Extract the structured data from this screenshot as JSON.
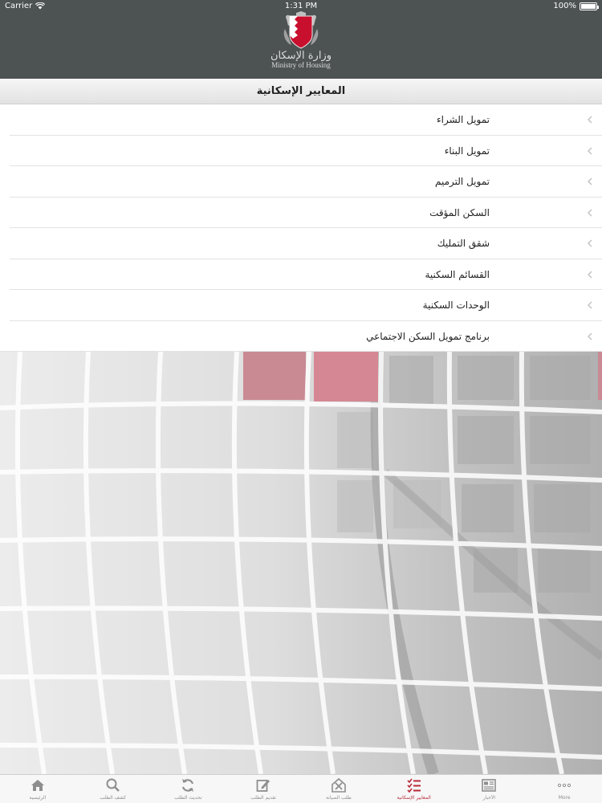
{
  "status_bar": {
    "carrier": "Carrier",
    "time": "1:31 PM",
    "battery": "100%"
  },
  "header": {
    "logo_arabic": "وزارة الإسكان",
    "logo_english": "Ministry of Housing"
  },
  "page_title": "المعايير الإسكانية",
  "items": [
    {
      "label": "تمويل الشراء"
    },
    {
      "label": "تمويل البناء"
    },
    {
      "label": "تمويل الترميم"
    },
    {
      "label": "السكن المؤقت"
    },
    {
      "label": "شقق التمليك"
    },
    {
      "label": "القسائم السكنية"
    },
    {
      "label": "الوحدات السكنية"
    },
    {
      "label": "برنامج تمويل السكن الاجتماعي"
    }
  ],
  "tabs": [
    {
      "label": "الرئيسية",
      "icon": "home-icon"
    },
    {
      "label": "كشف الطلب",
      "icon": "search-icon"
    },
    {
      "label": "تحديث الطلب",
      "icon": "refresh-icon"
    },
    {
      "label": "تقديم الطلب",
      "icon": "edit-icon"
    },
    {
      "label": "طلب الصيانة",
      "icon": "maintenance-icon"
    },
    {
      "label": "المعايير الإسكانية",
      "icon": "list-icon"
    },
    {
      "label": "الأخبار",
      "icon": "news-icon"
    },
    {
      "label": "More",
      "icon": "more-icon"
    }
  ],
  "active_tab": "المعايير الإسكانية",
  "colors": {
    "header_bg": "#4d5252",
    "accent": "#b82a39"
  }
}
